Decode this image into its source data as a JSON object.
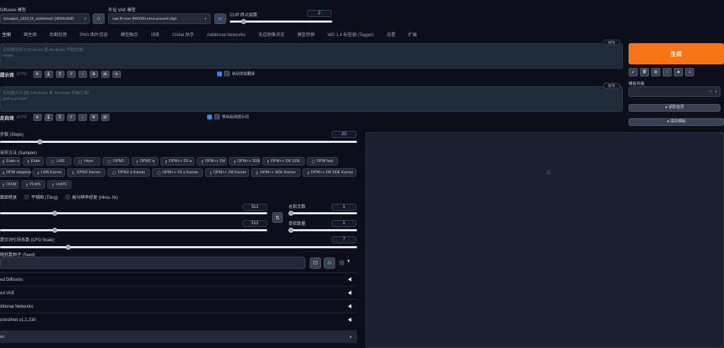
{
  "header": {
    "model_label": "Diffusion 模型",
    "model_value": "tomated_v333 (4_celebmom [4596e6d0",
    "vae_label": "外挂 VAE 模型",
    "vae_value": "vae-ft-mse-840000-ema-pruned.ckpt",
    "clip_label": "CLIP 终止层数",
    "clip_value": "2"
  },
  "tabs": [
    "生图",
    "图生图",
    "后期处理",
    "PNG 图片信息",
    "模型融合",
    "训练",
    "Civitai 助手",
    "Additional Networks",
    "无边图像浏览",
    "模型转换",
    "WD 1.4 标签器 (Tagger)",
    "设置",
    "扩展"
  ],
  "prompt": {
    "placeholder_line1": "正向提示词 (Ctrl+Enter 或 Alt+Enter 开始生成)",
    "placeholder_line2": "rompt",
    "counter": "0/75",
    "label": "提示词",
    "tokens": "(0/75)",
    "checkbox_label": "自动添加翻译"
  },
  "negative": {
    "placeholder_line1": "反向提示词 (按 Ctrl+Enter 或 Alt+Enter 开始生成)",
    "placeholder_line2": "gative prompt",
    "counter": "0/75",
    "label": "反向词",
    "tokens": "(0/75)",
    "checkbox_label": "移出反向提示词"
  },
  "generate": {
    "label": "生成",
    "styles_label": "模板风格",
    "btn_apply": "● 读取选项",
    "btn_save": "● 保存模板"
  },
  "steps": {
    "label": "步数 (Steps)",
    "value": "20",
    "fraction": 0.133
  },
  "sampler": {
    "label": "采样方法 (Sampler)",
    "options_row1": [
      "Euler a",
      "Euler",
      "LMS",
      "Heun",
      "DPM2",
      "DPM2 a",
      "DPM++ 2S a",
      "DPM++ 2M",
      "DPM++ SDE",
      "DPM++ 2M SDE",
      "DPM fast"
    ],
    "options_row2": [
      "DPM adaptive",
      "LMS Karras",
      "DPM2 Karras",
      "DPM2 a Karras",
      "DPM++ 2S a Karras",
      "DPM++ 2M Karras",
      "DPM++ SDE Karras",
      "DPM++ 2M SDE Karras"
    ],
    "options_row3": [
      "DDIM",
      "PLMS",
      "UniPC"
    ]
  },
  "options": {
    "restore_faces": "面部修复",
    "tiling": "平铺图 (Tiling)",
    "hires_fix": "高分辨率修复 (Hires. fix)"
  },
  "width": {
    "value": "512",
    "fraction": 0.15
  },
  "height": {
    "value": "512",
    "fraction": 0.15
  },
  "batch_count": {
    "label": "总批次数",
    "value": "1",
    "fraction": 0.0
  },
  "batch_size": {
    "label": "单批数量",
    "value": "1",
    "fraction": 0.0
  },
  "cfg": {
    "label": "提示词引导系数 (CFG Scale)",
    "value": "7",
    "fraction": 0.19
  },
  "seed": {
    "label": "随机数种子 (Seed)",
    "value": ""
  },
  "accordions": [
    "ed Diffusion",
    "ed VAE",
    "ditional Networks",
    "ontrolNet v1.1.230",
    "ric"
  ],
  "colors": {
    "accent": "#f97316",
    "bg": "#0b0f19",
    "panel": "#1f2937"
  }
}
